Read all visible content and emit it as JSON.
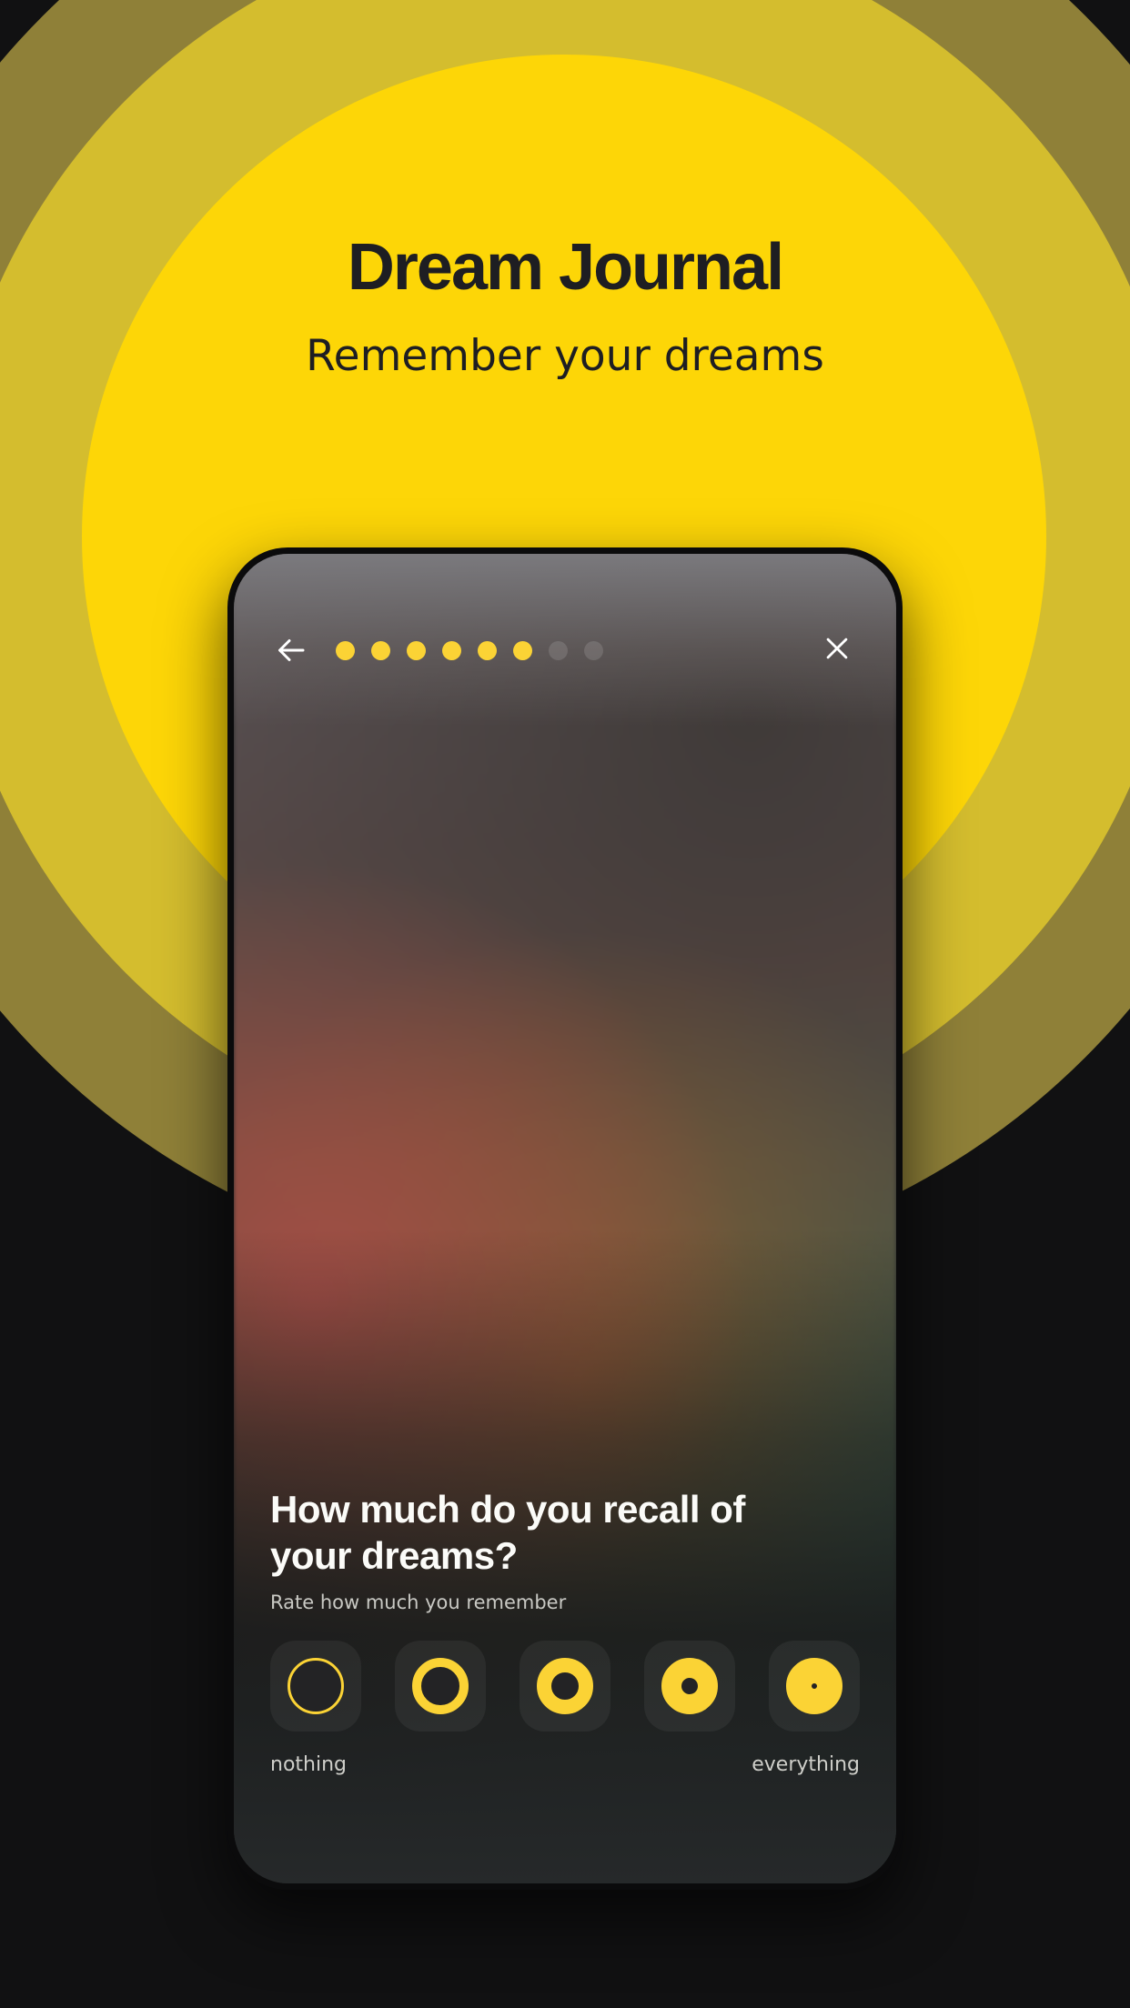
{
  "hero": {
    "title": "Dream Journal",
    "subtitle": "Remember your dreams"
  },
  "colors": {
    "brand_yellow": "#fdd607",
    "ring_mid": "#d4bd2e",
    "ring_outer": "#8f8038",
    "page_background": "#111112",
    "accent_dot": "#fbd335",
    "text_light": "#fbfbf8"
  },
  "phone": {
    "header": {
      "back_icon": "arrow-left-icon",
      "close_icon": "close-icon",
      "progress": {
        "total": 8,
        "completed": 6,
        "dots": [
          {
            "state": "active"
          },
          {
            "state": "active"
          },
          {
            "state": "active"
          },
          {
            "state": "active"
          },
          {
            "state": "active"
          },
          {
            "state": "active"
          },
          {
            "state": "inactive"
          },
          {
            "state": "inactive"
          }
        ]
      }
    },
    "question": {
      "title": "How much do you recall of your dreams?",
      "subtitle": "Rate how much you remember",
      "options": [
        {
          "value": 1,
          "fill": "r1"
        },
        {
          "value": 2,
          "fill": "r2"
        },
        {
          "value": 3,
          "fill": "r3"
        },
        {
          "value": 4,
          "fill": "r4"
        },
        {
          "value": 5,
          "fill": "r5"
        }
      ],
      "scale_min_label": "nothing",
      "scale_max_label": "everything"
    }
  }
}
